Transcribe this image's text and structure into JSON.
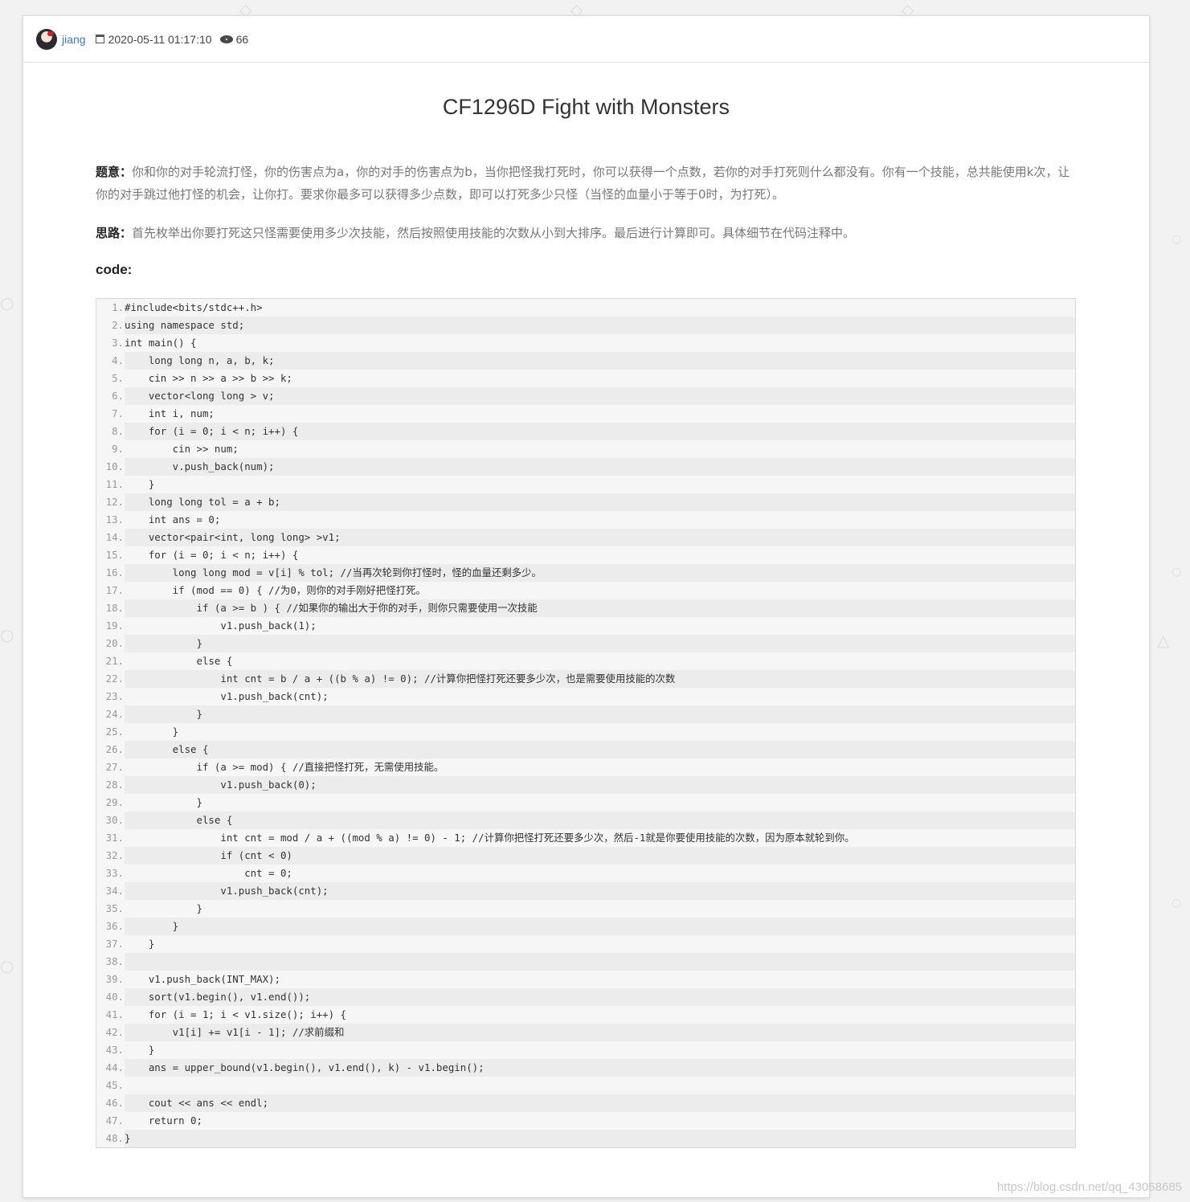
{
  "post": {
    "author": "jiang",
    "datetime": "2020-05-11 01:17:10",
    "views": "66",
    "title": "CF1296D Fight with Monsters",
    "problem_label": "题意：",
    "problem_text": "你和你的对手轮流打怪，你的伤害点为a，你的对手的伤害点为b，当你把怪我打死时，你可以获得一个点数，若你的对手打死则什么都没有。你有一个技能，总共能使用k次，让你的对手跳过他打怪的机会，让你打。要求你最多可以获得多少点数，即可以打死多少只怪（当怪的血量小于等于0时，为打死）。",
    "idea_label": "思路：",
    "idea_text": "首先枚举出你要打死这只怪需要使用多少次技能，然后按照使用技能的次数从小到大排序。最后进行计算即可。具体细节在代码注释中。",
    "code_heading": "code:"
  },
  "code": [
    {
      "n": "1.",
      "t": "#include<bits/stdc++.h>"
    },
    {
      "n": "2.",
      "t": "using namespace std;"
    },
    {
      "n": "3.",
      "t": "int main() {"
    },
    {
      "n": "4.",
      "t": "    long long n, a, b, k;"
    },
    {
      "n": "5.",
      "t": "    cin >> n >> a >> b >> k;"
    },
    {
      "n": "6.",
      "t": "    vector<long long > v;"
    },
    {
      "n": "7.",
      "t": "    int i, num;"
    },
    {
      "n": "8.",
      "t": "    for (i = 0; i < n; i++) {"
    },
    {
      "n": "9.",
      "t": "        cin >> num;"
    },
    {
      "n": "10.",
      "t": "        v.push_back(num);"
    },
    {
      "n": "11.",
      "t": "    }"
    },
    {
      "n": "12.",
      "t": "    long long tol = a + b;"
    },
    {
      "n": "13.",
      "t": "    int ans = 0;"
    },
    {
      "n": "14.",
      "t": "    vector<pair<int, long long> >v1;"
    },
    {
      "n": "15.",
      "t": "    for (i = 0; i < n; i++) {"
    },
    {
      "n": "16.",
      "t": "        long long mod = v[i] % tol; //当再次轮到你打怪时，怪的血量还剩多少。"
    },
    {
      "n": "17.",
      "t": "        if (mod == 0) { //为0，则你的对手刚好把怪打死。"
    },
    {
      "n": "18.",
      "t": "            if (a >= b ) { //如果你的输出大于你的对手，则你只需要使用一次技能"
    },
    {
      "n": "19.",
      "t": "                v1.push_back(1);"
    },
    {
      "n": "20.",
      "t": "            }"
    },
    {
      "n": "21.",
      "t": "            else {"
    },
    {
      "n": "22.",
      "t": "                int cnt = b / a + ((b % a) != 0); //计算你把怪打死还要多少次，也是需要使用技能的次数"
    },
    {
      "n": "23.",
      "t": "                v1.push_back(cnt);"
    },
    {
      "n": "24.",
      "t": "            }"
    },
    {
      "n": "25.",
      "t": "        }"
    },
    {
      "n": "26.",
      "t": "        else {"
    },
    {
      "n": "27.",
      "t": "            if (a >= mod) { //直接把怪打死，无需使用技能。"
    },
    {
      "n": "28.",
      "t": "                v1.push_back(0);"
    },
    {
      "n": "29.",
      "t": "            }"
    },
    {
      "n": "30.",
      "t": "            else {"
    },
    {
      "n": "31.",
      "t": "                int cnt = mod / a + ((mod % a) != 0) - 1; //计算你把怪打死还要多少次，然后-1就是你要使用技能的次数，因为原本就轮到你。"
    },
    {
      "n": "32.",
      "t": "                if (cnt < 0)"
    },
    {
      "n": "33.",
      "t": "                    cnt = 0;"
    },
    {
      "n": "34.",
      "t": "                v1.push_back(cnt);"
    },
    {
      "n": "35.",
      "t": "            }"
    },
    {
      "n": "36.",
      "t": "        }"
    },
    {
      "n": "37.",
      "t": "    }"
    },
    {
      "n": "38.",
      "t": ""
    },
    {
      "n": "39.",
      "t": "    v1.push_back(INT_MAX);"
    },
    {
      "n": "40.",
      "t": "    sort(v1.begin(), v1.end());"
    },
    {
      "n": "41.",
      "t": "    for (i = 1; i < v1.size(); i++) {"
    },
    {
      "n": "42.",
      "t": "        v1[i] += v1[i - 1]; //求前缀和"
    },
    {
      "n": "43.",
      "t": "    }"
    },
    {
      "n": "44.",
      "t": "    ans = upper_bound(v1.begin(), v1.end(), k) - v1.begin();"
    },
    {
      "n": "45.",
      "t": ""
    },
    {
      "n": "46.",
      "t": "    cout << ans << endl;"
    },
    {
      "n": "47.",
      "t": "    return 0;"
    },
    {
      "n": "48.",
      "t": "}"
    }
  ],
  "watermark": "https://blog.csdn.net/qq_43058685"
}
